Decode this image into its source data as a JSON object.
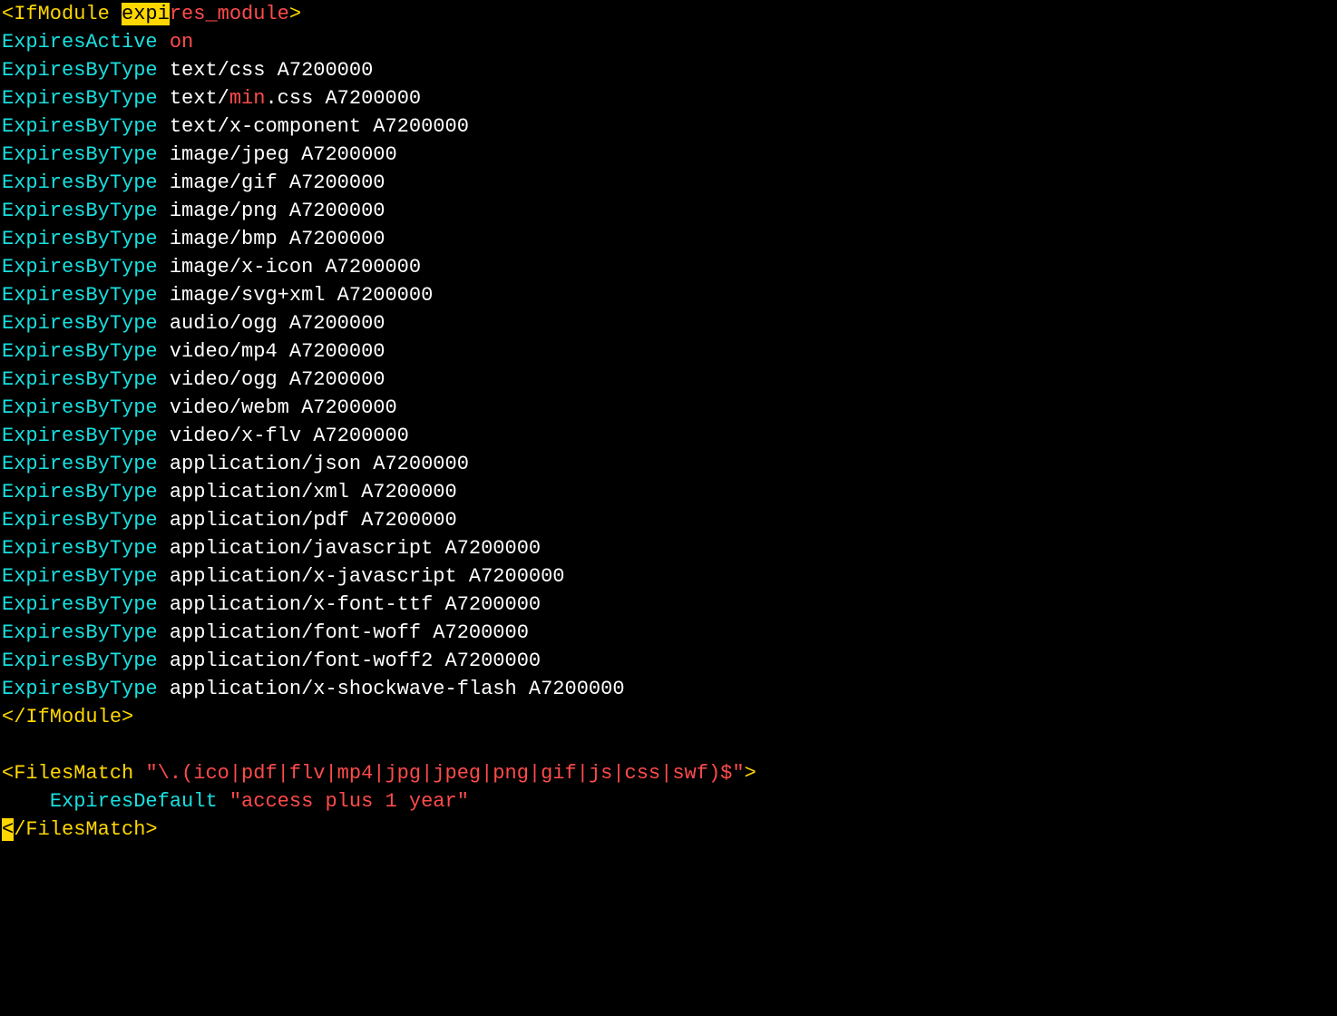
{
  "ifmodule": {
    "open_bracket": "<",
    "open_tag": "IfModule ",
    "search_match": "expi",
    "module_suffix": "res_module",
    "open_close_bracket": ">",
    "close_tag": "</IfModule>"
  },
  "expires_active": {
    "directive": "ExpiresActive",
    "value": "on"
  },
  "rules": [
    {
      "d": "ExpiresByType",
      "pre": " text/css A7200000",
      "hl": "",
      "post": ""
    },
    {
      "d": "ExpiresByType",
      "pre": " text/",
      "hl": "min",
      "post": ".css A7200000"
    },
    {
      "d": "ExpiresByType",
      "pre": " text/x-component A7200000",
      "hl": "",
      "post": ""
    },
    {
      "d": "ExpiresByType",
      "pre": " image/jpeg A7200000",
      "hl": "",
      "post": ""
    },
    {
      "d": "ExpiresByType",
      "pre": " image/gif A7200000",
      "hl": "",
      "post": ""
    },
    {
      "d": "ExpiresByType",
      "pre": " image/png A7200000",
      "hl": "",
      "post": ""
    },
    {
      "d": "ExpiresByType",
      "pre": " image/bmp A7200000",
      "hl": "",
      "post": ""
    },
    {
      "d": "ExpiresByType",
      "pre": " image/x-icon A7200000",
      "hl": "",
      "post": ""
    },
    {
      "d": "ExpiresByType",
      "pre": " image/svg+xml A7200000",
      "hl": "",
      "post": ""
    },
    {
      "d": "ExpiresByType",
      "pre": " audio/ogg A7200000",
      "hl": "",
      "post": ""
    },
    {
      "d": "ExpiresByType",
      "pre": " video/mp4 A7200000",
      "hl": "",
      "post": ""
    },
    {
      "d": "ExpiresByType",
      "pre": " video/ogg A7200000",
      "hl": "",
      "post": ""
    },
    {
      "d": "ExpiresByType",
      "pre": " video/webm A7200000",
      "hl": "",
      "post": ""
    },
    {
      "d": "ExpiresByType",
      "pre": " video/x-flv A7200000",
      "hl": "",
      "post": ""
    },
    {
      "d": "ExpiresByType",
      "pre": " application/json A7200000",
      "hl": "",
      "post": ""
    },
    {
      "d": "ExpiresByType",
      "pre": " application/xml A7200000",
      "hl": "",
      "post": ""
    },
    {
      "d": "ExpiresByType",
      "pre": " application/pdf A7200000",
      "hl": "",
      "post": ""
    },
    {
      "d": "ExpiresByType",
      "pre": " application/javascript A7200000",
      "hl": "",
      "post": ""
    },
    {
      "d": "ExpiresByType",
      "pre": " application/x-javascript A7200000",
      "hl": "",
      "post": ""
    },
    {
      "d": "ExpiresByType",
      "pre": " application/x-font-ttf A7200000",
      "hl": "",
      "post": ""
    },
    {
      "d": "ExpiresByType",
      "pre": " application/font-woff A7200000",
      "hl": "",
      "post": ""
    },
    {
      "d": "ExpiresByType",
      "pre": " application/font-woff2 A7200000",
      "hl": "",
      "post": ""
    },
    {
      "d": "ExpiresByType",
      "pre": " application/x-shockwave-flash A7200000",
      "hl": "",
      "post": ""
    }
  ],
  "filesmatch": {
    "open_bracket": "<",
    "open_tag": "FilesMatch ",
    "pattern": "\"\\.(ico|pdf|flv|mp4|jpg|jpeg|png|gif|js|css|swf)$\"",
    "open_close_bracket": ">",
    "indent": "    ",
    "inner_directive": "ExpiresDefault",
    "inner_value": " \"access plus 1 year\"",
    "close_cursor": "<",
    "close_rest": "/FilesMatch>"
  },
  "blank_line": ""
}
